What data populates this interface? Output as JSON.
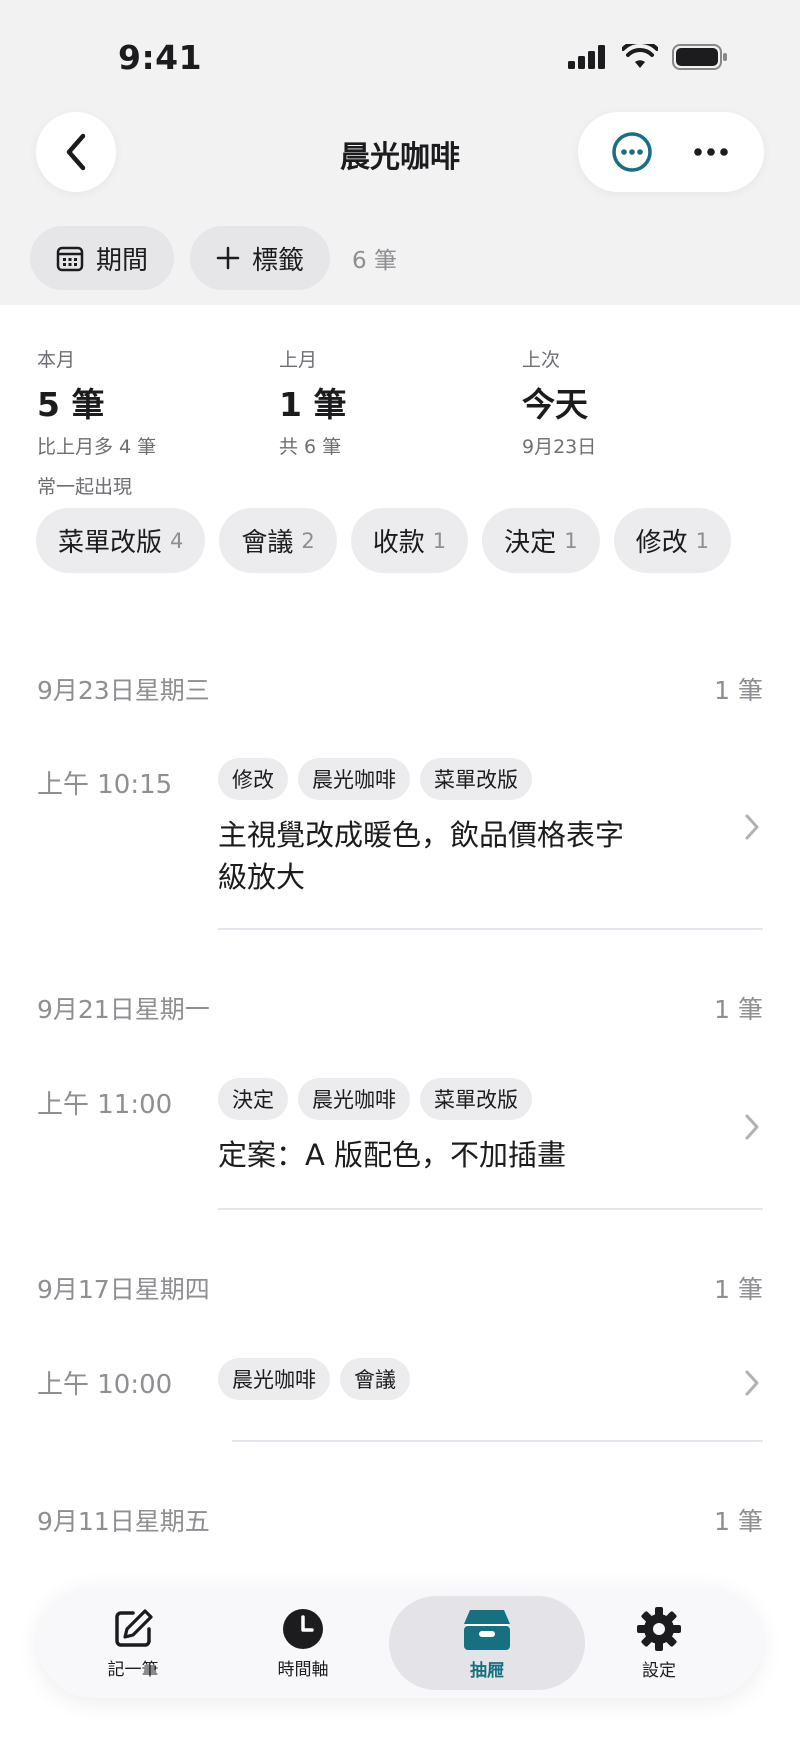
{
  "status": {
    "time": "9:41"
  },
  "nav": {
    "title": "晨光咖啡"
  },
  "filters": {
    "period_label": "期間",
    "tag_label": "標籤",
    "count": "6 筆"
  },
  "summary": {
    "this_month": {
      "label": "本月",
      "value": "5 筆",
      "sub": "比上月多 4 筆"
    },
    "last_month": {
      "label": "上月",
      "value": "1 筆",
      "sub": "共 6 筆"
    },
    "last_time": {
      "label": "上次",
      "value": "今天",
      "sub": "9月23日"
    },
    "co_label": "常一起出現",
    "co_chips": [
      {
        "label": "菜單改版",
        "count": "4"
      },
      {
        "label": "會議",
        "count": "2"
      },
      {
        "label": "收款",
        "count": "1"
      },
      {
        "label": "決定",
        "count": "1"
      },
      {
        "label": "修改",
        "count": "1"
      }
    ]
  },
  "days": [
    {
      "date": "9月23日星期三",
      "count": "1 筆",
      "entry": {
        "time": "上午 10:15",
        "tags": [
          "修改",
          "晨光咖啡",
          "菜單改版"
        ],
        "text": "主視覺改成暖色，飲品價格表字級放大"
      }
    },
    {
      "date": "9月21日星期一",
      "count": "1 筆",
      "entry": {
        "time": "上午 11:00",
        "tags": [
          "決定",
          "晨光咖啡",
          "菜單改版"
        ],
        "text": "定案：A 版配色，不加插畫"
      }
    },
    {
      "date": "9月17日星期四",
      "count": "1 筆",
      "entry": {
        "time": "上午 10:00",
        "tags": [
          "晨光咖啡",
          "會議"
        ],
        "text": ""
      }
    },
    {
      "date": "9月11日星期五",
      "count": "1 筆"
    }
  ],
  "tabs": [
    {
      "label": "記一筆",
      "icon": "compose-icon"
    },
    {
      "label": "時間軸",
      "icon": "clock-icon"
    },
    {
      "label": "抽屜",
      "icon": "drawer-icon",
      "active": true
    },
    {
      "label": "設定",
      "icon": "gear-icon"
    }
  ],
  "colors": {
    "accent": "#17707f",
    "chip_bg": "#ececef",
    "muted": "#8e8e93"
  }
}
